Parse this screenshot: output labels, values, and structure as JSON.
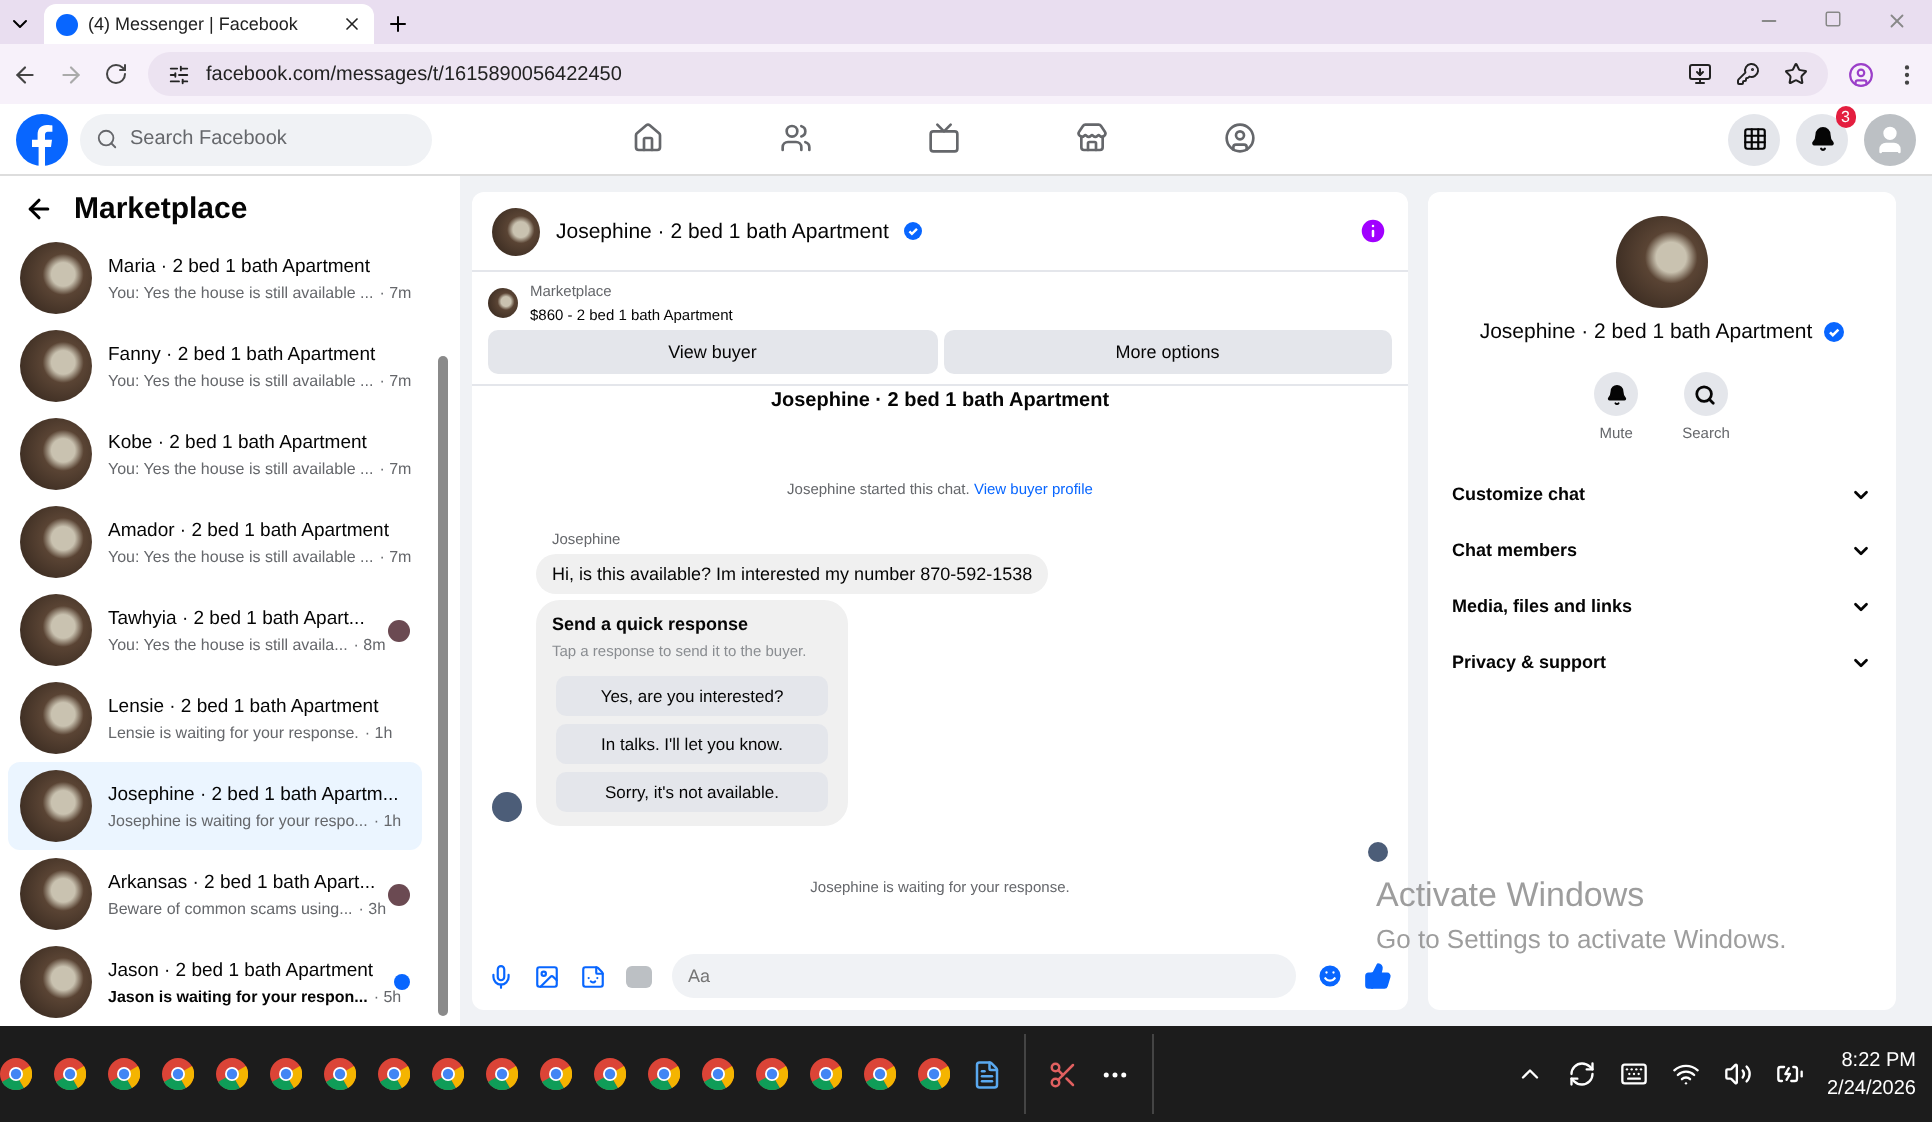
{
  "browser": {
    "tab_title": "(4) Messenger | Facebook",
    "url": "facebook.com/messages/t/1615890056422450"
  },
  "header": {
    "search": {
      "placeholder": "Search Facebook"
    },
    "nav": [
      {
        "kind": "home",
        "selected": false
      },
      {
        "kind": "friends",
        "selected": false
      },
      {
        "kind": "video",
        "selected": false
      },
      {
        "kind": "marketplace",
        "selected": false
      },
      {
        "kind": "groups",
        "selected": false
      }
    ],
    "notification_count": "3"
  },
  "sidebar": {
    "title": "Marketplace",
    "conversations": [
      {
        "name": "Maria · 2 bed 1 bath Apartment",
        "preview": "You: Yes the house is still available ...",
        "time": "· 7m",
        "selected": false,
        "unread": false,
        "seen": false
      },
      {
        "name": "Fanny · 2 bed 1 bath Apartment",
        "preview": "You: Yes the house is still available ...",
        "time": "· 7m",
        "selected": false,
        "unread": false,
        "seen": false
      },
      {
        "name": "Kobe · 2 bed 1 bath Apartment",
        "preview": "You: Yes the house is still available ...",
        "time": "· 7m",
        "selected": false,
        "unread": false,
        "seen": false
      },
      {
        "name": "Amador · 2 bed 1 bath Apartment",
        "preview": "You: Yes the house is still available ...",
        "time": "· 7m",
        "selected": false,
        "unread": false,
        "seen": false
      },
      {
        "name": "Tawhyia · 2 bed 1 bath Apart...",
        "preview": "You: Yes the house is still availa...",
        "time": "· 8m",
        "selected": false,
        "unread": false,
        "seen": true
      },
      {
        "name": "Lensie · 2 bed 1 bath Apartment",
        "preview": "Lensie is waiting for your response.",
        "time": "· 1h",
        "selected": false,
        "unread": false,
        "seen": false
      },
      {
        "name": "Josephine · 2 bed 1 bath Apartm...",
        "preview": "Josephine is waiting for your respo...",
        "time": "· 1h",
        "selected": true,
        "unread": false,
        "seen": false
      },
      {
        "name": "Arkansas · 2 bed 1 bath Apart...",
        "preview": "Beware of common scams using...",
        "time": "· 3h",
        "selected": false,
        "unread": false,
        "seen": true
      },
      {
        "name": "Jason · 2 bed 1 bath Apartment",
        "preview": "Jason is waiting for your respon...",
        "time": "· 5h",
        "selected": false,
        "unread": true,
        "seen": false
      }
    ]
  },
  "chat": {
    "title": "Josephine · 2 bed 1 bath Apartment",
    "listing": {
      "label": "Marketplace",
      "item": "$860 - 2 bed 1 bath Apartment"
    },
    "buttons": [
      "View buyer",
      "More options"
    ],
    "cut_heading": "Josephine · 2 bed 1 bath Apartment",
    "started": "Josephine started this chat.",
    "started_link": "View buyer profile",
    "sender": "Josephine",
    "message": "Hi, is this available? Im interested my number 870-592-1538",
    "quick": {
      "title": "Send a quick response",
      "hint": "Tap a response to send it to the buyer.",
      "options": [
        "Yes, are you interested?",
        "In talks. I'll let you know.",
        "Sorry, it's not available."
      ]
    },
    "waiting": "Josephine is waiting for your response.",
    "composer": {
      "placeholder": "Aa"
    }
  },
  "details": {
    "title": "Josephine · 2 bed 1 bath Apartment",
    "actions": [
      {
        "kind": "mute",
        "label": "Mute"
      },
      {
        "kind": "search",
        "label": "Search"
      }
    ],
    "sections": [
      "Customize chat",
      "Chat members",
      "Media, files and links",
      "Privacy & support"
    ]
  },
  "activation": {
    "title": "Activate Windows",
    "hint": "Go to Settings to activate Windows."
  },
  "taskbar": {
    "time": "8:22 PM",
    "date": "2/24/2026"
  }
}
